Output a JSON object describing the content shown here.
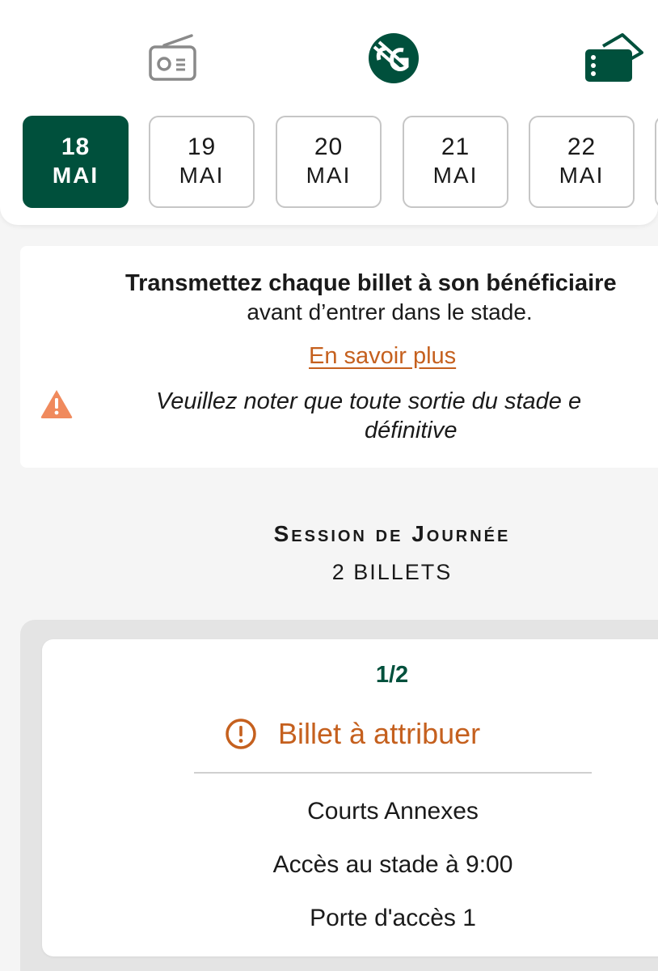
{
  "header": {
    "icons": {
      "radio": "radio-icon",
      "logo": "roland-garros-logo",
      "tickets": "ticket-icon"
    },
    "dates": [
      {
        "day": "18",
        "month": "MAI",
        "selected": true
      },
      {
        "day": "19",
        "month": "MAI",
        "selected": false
      },
      {
        "day": "20",
        "month": "MAI",
        "selected": false
      },
      {
        "day": "21",
        "month": "MAI",
        "selected": false
      },
      {
        "day": "22",
        "month": "MAI",
        "selected": false
      }
    ]
  },
  "notice": {
    "line1": "Transmettez chaque billet à son bénéficiaire",
    "line2": "avant d’entrer dans le stade.",
    "link": "En savoir plus",
    "warning_line1": "Veuillez noter que toute sortie du stade e",
    "warning_line2": "définitive",
    "warning_icon": "warning-icon"
  },
  "session": {
    "title": "Session de Journée",
    "count": "2 BILLETS"
  },
  "ticket": {
    "index": "1/2",
    "status": "Billet à attribuer",
    "status_icon": "alert-circle-icon",
    "court": "Courts Annexes",
    "access_time": "Accès au stade à 9:00",
    "gate": "Porte d'accès 1"
  },
  "colors": {
    "brand_green": "#00503c",
    "accent_orange": "#c5601e",
    "warning_orange": "#f08a5d",
    "background": "#f5f5f5"
  }
}
